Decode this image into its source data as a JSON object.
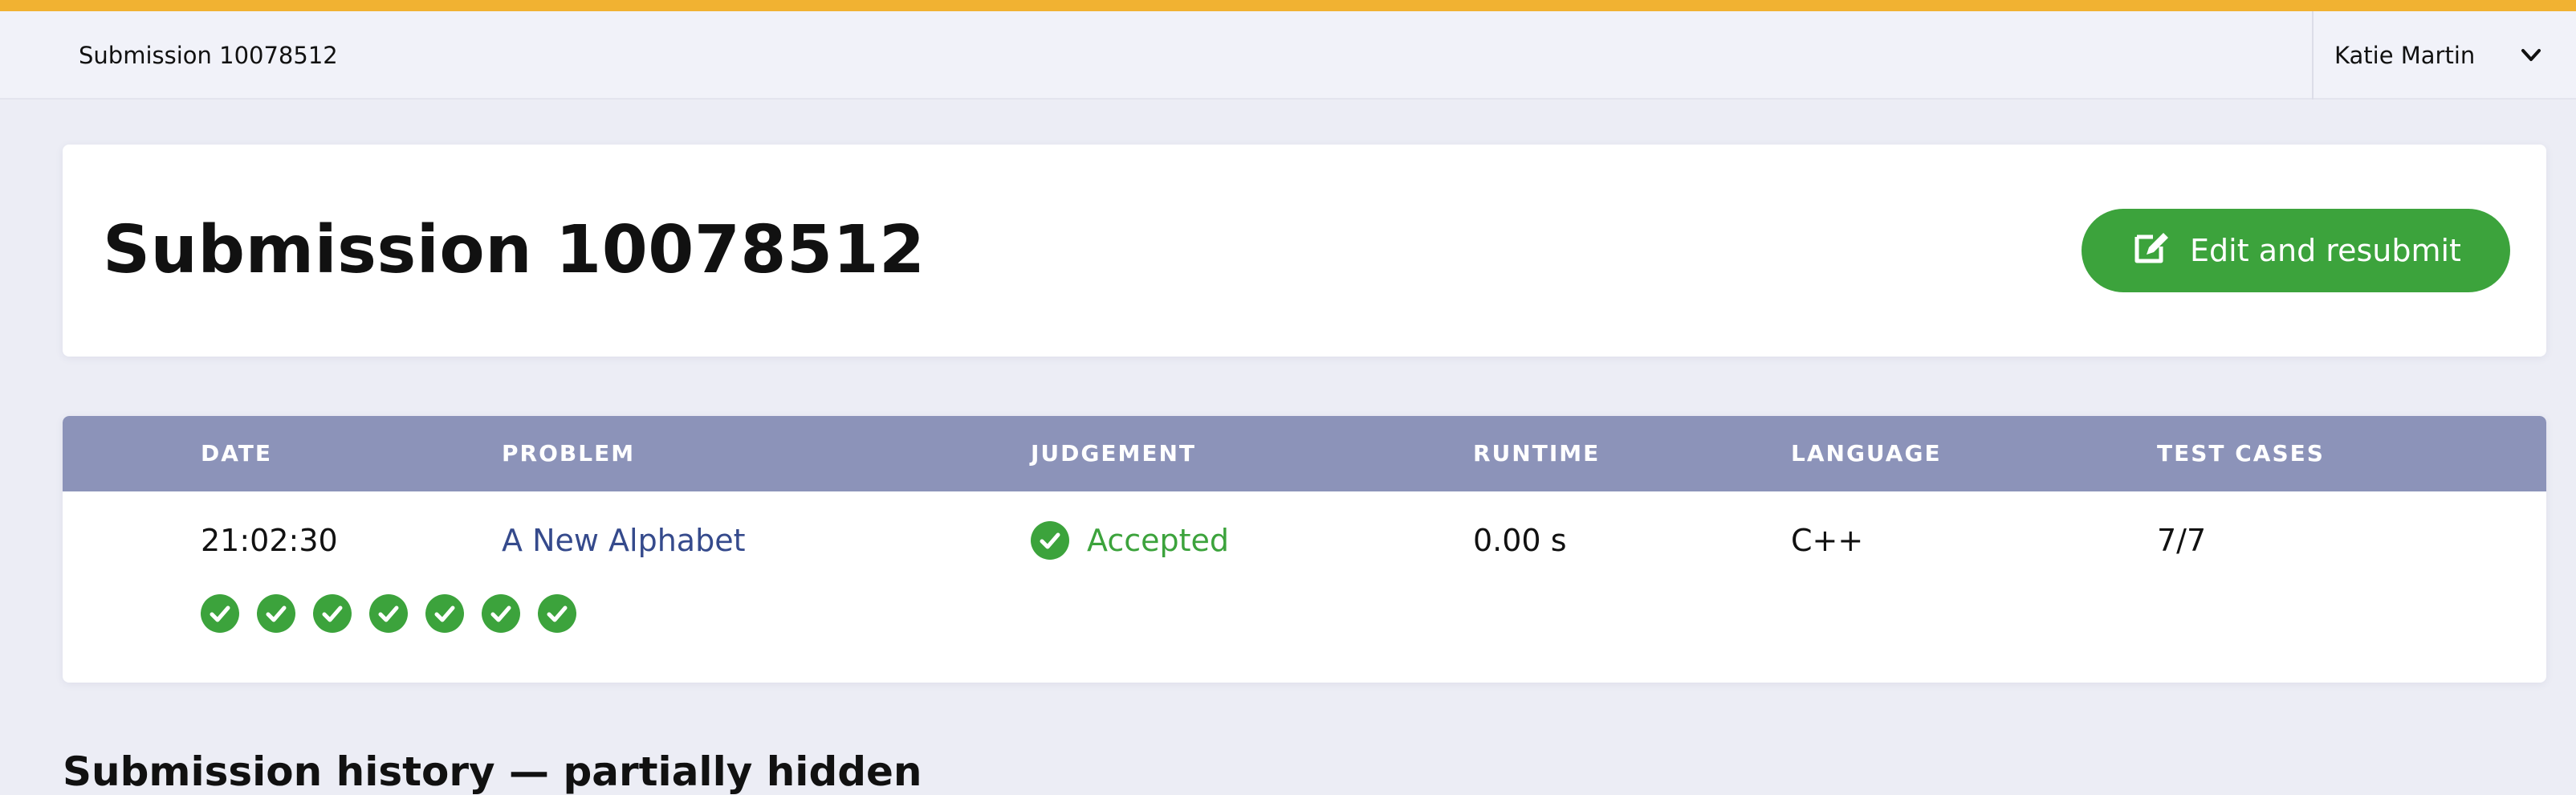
{
  "topbar": {
    "breadcrumb": "Submission 10078512",
    "user_name": "Katie Martin"
  },
  "header": {
    "title": "Submission 10078512",
    "resubmit_label": "Edit and resubmit"
  },
  "table": {
    "columns": [
      "DATE",
      "PROBLEM",
      "JUDGEMENT",
      "RUNTIME",
      "LANGUAGE",
      "TEST CASES"
    ],
    "row": {
      "date": "21:02:30",
      "problem": "A New Alphabet",
      "judgement": "Accepted",
      "runtime": "0.00 s",
      "language": "C++",
      "test_cases": "7/7"
    },
    "test_case_results": [
      "passed",
      "passed",
      "passed",
      "passed",
      "passed",
      "passed",
      "passed"
    ]
  },
  "footer": {
    "partial_heading": "Submission history — partially hidden"
  },
  "colors": {
    "accent": "#f1b232",
    "success": "#3ca33c",
    "table_header": "#8c93b9",
    "link": "#354a8c"
  },
  "icons": {
    "resubmit": "edit-icon",
    "user_menu": "chevron-down-icon",
    "status": "check-circle-icon"
  }
}
